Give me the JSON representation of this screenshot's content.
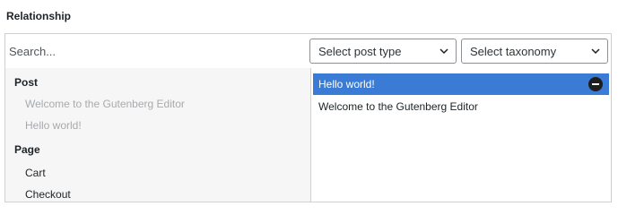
{
  "field": {
    "label": "Relationship"
  },
  "filters": {
    "search_placeholder": "Search...",
    "post_type_select": "Select post type",
    "taxonomy_select": "Select taxonomy"
  },
  "choices": {
    "groups": [
      {
        "label": "Post",
        "items": [
          {
            "label": "Welcome to the Gutenberg Editor",
            "disabled": true
          },
          {
            "label": "Hello world!",
            "disabled": true
          }
        ]
      },
      {
        "label": "Page",
        "items": [
          {
            "label": "Cart",
            "disabled": false
          },
          {
            "label": "Checkout",
            "disabled": false
          }
        ]
      }
    ]
  },
  "values": {
    "items": [
      {
        "label": "Hello world!",
        "highlighted": true
      },
      {
        "label": "Welcome to the Gutenberg Editor",
        "highlighted": false
      }
    ]
  },
  "colors": {
    "highlight": "#3a7bd5",
    "disabled_text": "#a7aaad",
    "choices_background": "#f6f6f6"
  },
  "icons": {
    "select_arrow": "chevron-down-icon",
    "remove": "minus-circle-icon"
  }
}
